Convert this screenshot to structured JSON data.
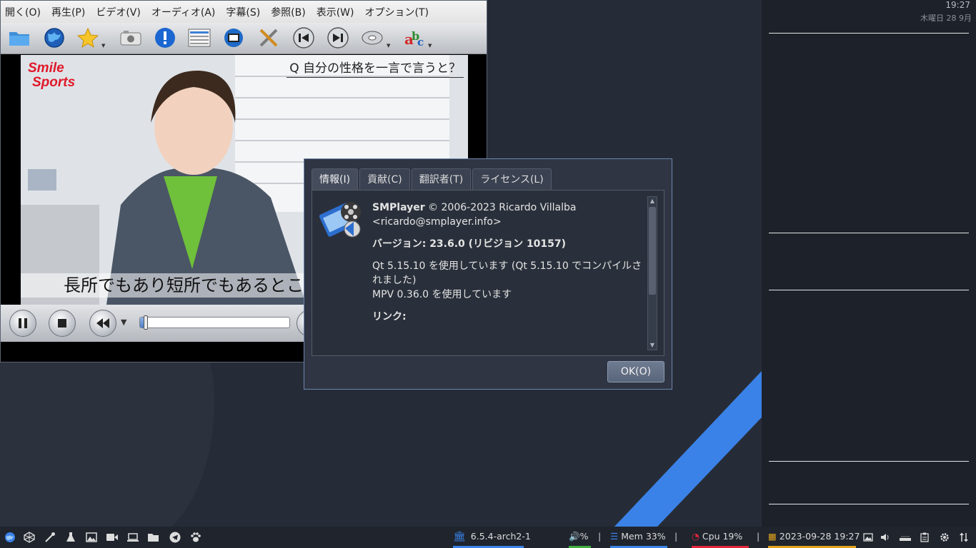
{
  "player": {
    "menu": [
      "開く(O)",
      "再生(P)",
      "ビデオ(V)",
      "オーディオ(A)",
      "字幕(S)",
      "参照(B)",
      "表示(W)",
      "オプション(T)"
    ],
    "toolbar_icons": [
      "folder-icon",
      "globe-icon",
      "favorite-star-icon",
      "screenshot-camera-icon",
      "info-icon",
      "playlist-icon",
      "video-settings-icon",
      "preferences-tools-icon",
      "previous-icon",
      "next-icon",
      "disc-icon",
      "subtitles-icon"
    ],
    "video": {
      "logo_line1": "Smile",
      "logo_line2": "Sports",
      "top_caption": "Q 自分の性格を一言で言うと？",
      "subtitle": "長所でもあり短所でもあるとこ"
    },
    "progress": 0.04
  },
  "about": {
    "tabs": [
      "情報(I)",
      "貢献(C)",
      "翻訳者(T)",
      "ライセンス(L)"
    ],
    "active_tab": 0,
    "app_name": "SMPlayer",
    "copyright": " © 2006-2023 Ricardo Villalba",
    "email": "<ricardo@smplayer.info>",
    "version": "バージョン: 23.6.0 (リビジョン 10157)",
    "qt_line": "Qt 5.15.10 を使用しています (Qt 5.15.10 でコンパイルされました)",
    "mpv_line": "MPV 0.36.0 を使用しています",
    "links_heading": "リンク:",
    "ok_label": "OK(O)"
  },
  "conky": {
    "time": "19:27",
    "date": "木曜日 28 9月"
  },
  "taskbar": {
    "kernel": "6.5.4-arch2-1",
    "volume": "%",
    "mem": "Mem 33%",
    "cpu": "Cpu  19%",
    "datetime": "2023-09-28 19:27",
    "sep": "|",
    "colors": {
      "kernel": "#3b82e8",
      "volume": "#3fae3f",
      "mem": "#3b82e8",
      "cpu": "#e0253c",
      "datetime": "#e0a21c"
    }
  }
}
